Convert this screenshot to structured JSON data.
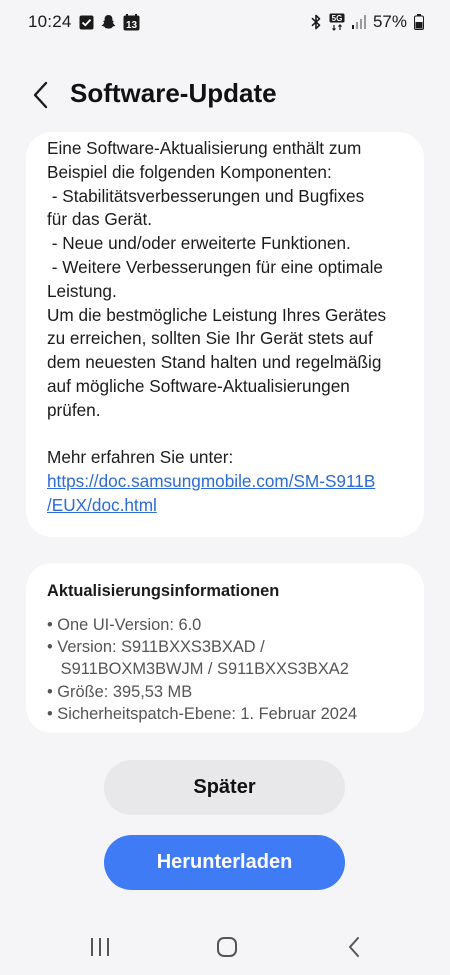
{
  "status_bar": {
    "time": "10:24",
    "network": "5G",
    "battery": "57%",
    "icons_left": [
      "checkbox-icon",
      "snapchat-icon",
      "calendar-icon"
    ],
    "calendar_day": "13",
    "icons_right": [
      "bluetooth-icon",
      "network-5g-icon",
      "signal-icon",
      "battery-icon"
    ]
  },
  "header": {
    "title": "Software-Update",
    "back_icon": "back-chevron-icon"
  },
  "description": {
    "lines": [
      "Eine Software-Aktualisierung enthält zum",
      "Beispiel die folgenden Komponenten:",
      " - Stabilitätsverbesserungen und Bugfixes",
      "für das Gerät.",
      " - Neue und/oder erweiterte Funktionen.",
      " - Weitere Verbesserungen für eine optimale",
      "Leistung.",
      "Um die bestmögliche Leistung Ihres Gerätes",
      "zu erreichen, sollten Sie Ihr Gerät stets auf",
      "dem neuesten Stand halten und regelmäßig",
      "auf mögliche Software-Aktualisierungen",
      "prüfen."
    ],
    "more_label": "Mehr erfahren Sie unter:",
    "link_line1": "https://doc.samsungmobile.com/SM-S911B",
    "link_line2": "/EUX/doc.html",
    "link_color": "#2c6bd6"
  },
  "update_info": {
    "title": "Aktualisierungsinformationen",
    "lines": [
      "• One UI-Version: 6.0",
      "• Version: S911BXXS3BXAD /",
      "   S911BOXM3BWJM / S911BXXS3BXA2",
      "• Größe: 395,53 MB",
      "• Sicherheitspatch-Ebene: 1. Februar 2024"
    ]
  },
  "buttons": {
    "later_label": "Später",
    "download_label": "Herunterladen",
    "download_color": "#3e7bf5"
  },
  "nav_bar": {
    "icons": [
      "recent-apps-icon",
      "home-icon",
      "back-icon"
    ]
  }
}
